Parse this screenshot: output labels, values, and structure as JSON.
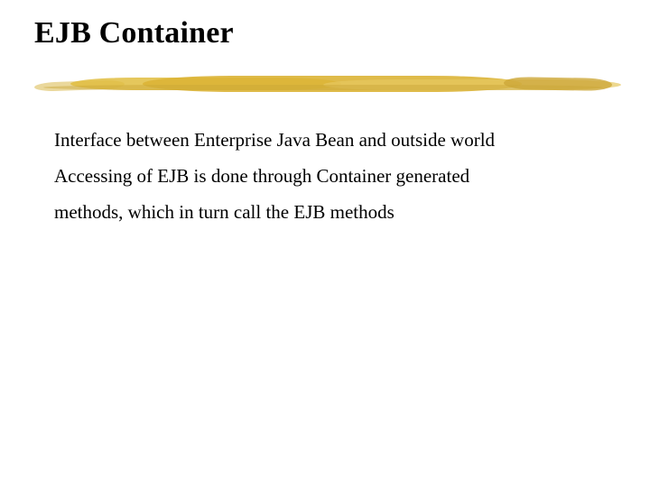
{
  "title": "EJB Container",
  "body": {
    "line1": "Interface between Enterprise Java Bean and outside world",
    "line2": "Accessing of EJB is done through Container generated",
    "line3": "methods, which in turn call the EJB methods"
  }
}
